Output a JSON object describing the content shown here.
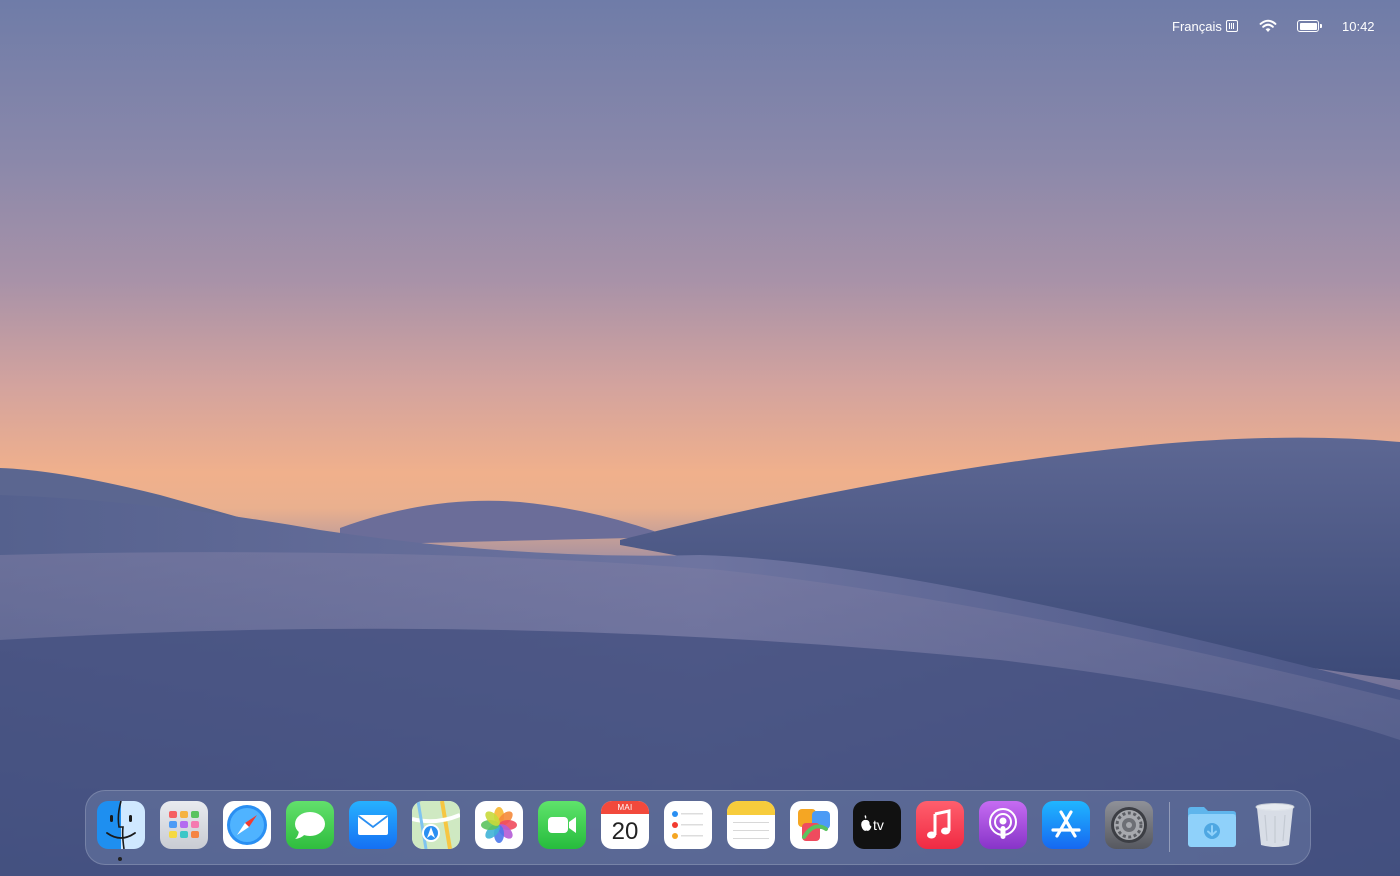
{
  "desktop": {
    "wallpaper": "dunes-sunset-wallpaper"
  },
  "menubar": {
    "input_source": "Français",
    "wifi_icon": "wifi-icon",
    "battery_icon": "battery-icon",
    "time": "10:42"
  },
  "dock": {
    "apps": [
      {
        "name": "Finder",
        "icon": "finder-icon"
      },
      {
        "name": "Launchpad",
        "icon": "launchpad-icon"
      },
      {
        "name": "Safari",
        "icon": "safari-icon"
      },
      {
        "name": "Messages",
        "icon": "messages-icon"
      },
      {
        "name": "Mail",
        "icon": "mail-icon"
      },
      {
        "name": "Maps",
        "icon": "maps-icon"
      },
      {
        "name": "Photos",
        "icon": "photos-icon"
      },
      {
        "name": "FaceTime",
        "icon": "facetime-icon"
      },
      {
        "name": "Calendar",
        "icon": "calendar-icon",
        "month": "MAI",
        "day": "20"
      },
      {
        "name": "Reminders",
        "icon": "reminders-icon"
      },
      {
        "name": "Notes",
        "icon": "notes-icon"
      },
      {
        "name": "Freeform",
        "icon": "freeform-icon"
      },
      {
        "name": "TV",
        "icon": "apple-tv-icon",
        "label": "tv"
      },
      {
        "name": "Music",
        "icon": "music-icon"
      },
      {
        "name": "Podcasts",
        "icon": "podcasts-icon"
      },
      {
        "name": "App Store",
        "icon": "app-store-icon"
      },
      {
        "name": "System Settings",
        "icon": "settings-gear-icon"
      },
      {
        "name": "Downloads",
        "icon": "downloads-folder-icon"
      },
      {
        "name": "Trash",
        "icon": "trash-icon"
      }
    ],
    "running": [
      "Finder"
    ]
  }
}
